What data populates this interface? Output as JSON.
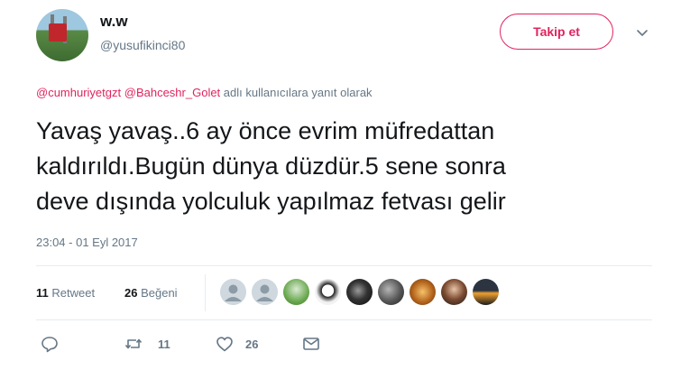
{
  "user": {
    "display_name": "w.w",
    "handle": "@yusufikinci80"
  },
  "follow_button": "Takip et",
  "reply_context": {
    "mentions": [
      "@cumhuriyetgzt",
      "@Bahceshr_Golet"
    ],
    "text": "adlı kullanıcılara yanıt olarak"
  },
  "tweet": {
    "text": "Yavaş yavaş..6 ay önce evrim müfredattan\nkaldırıldı.Bugün dünya düzdür.5 sene sonra\ndeve dışında yolculuk yapılmaz fetvası gelir",
    "timestamp": "23:04 - 01 Eyl 2017"
  },
  "stats": {
    "retweets_count": "11",
    "retweets_label": "Retweet",
    "likes_count": "26",
    "likes_label": "Beğeni"
  },
  "actions": {
    "retweet_count": "11",
    "like_count": "26"
  },
  "colors": {
    "accent": "#e0245e",
    "muted": "#657786",
    "divider": "#e6ecf0"
  },
  "icons": [
    "caret-down-icon",
    "reply-icon",
    "retweet-icon",
    "heart-icon",
    "message-icon"
  ]
}
